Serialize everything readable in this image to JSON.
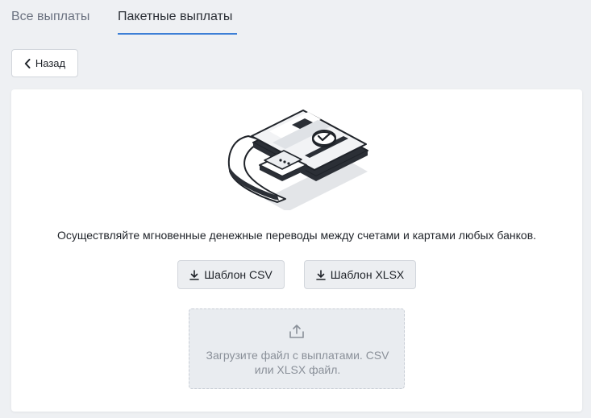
{
  "tabs": {
    "all_payouts": "Все выплаты",
    "batch_payouts": "Пакетные выплаты"
  },
  "back_button": {
    "label": "Назад",
    "icon": "chevron-left-icon"
  },
  "main": {
    "description": "Осуществляйте мгновенные денежные переводы между счетами и картами любых банков.",
    "csv_button": "Шаблон CSV",
    "xlsx_button": "Шаблон XLSX",
    "upload_text": "Загрузите файл с выплатами. CSV или XLSX файл."
  },
  "colors": {
    "active_tab_underline": "#3d7fd6",
    "page_background": "#eef0f3",
    "card_background": "#ffffff",
    "upload_zone": "#e9ecf0"
  }
}
